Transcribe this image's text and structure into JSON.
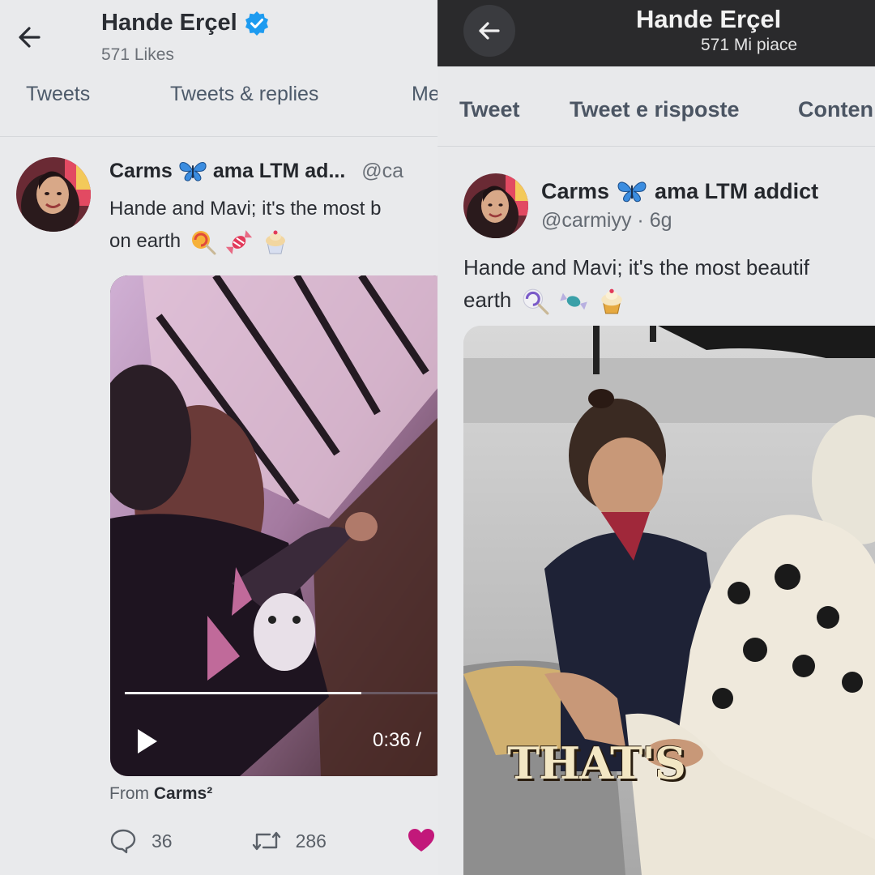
{
  "left": {
    "header": {
      "title": "Hande Erçel",
      "subtitle": "571 Likes"
    },
    "tabs": [
      "Tweets",
      "Tweets & replies",
      "Me"
    ],
    "tweet": {
      "name": "Carms",
      "name_suffix": "ama LTM ad...",
      "handle": "@ca",
      "text_line1": "Hande and Mavi; it's the most b",
      "text_line2": "on earth",
      "video_time": "0:36 /",
      "from_prefix": "From",
      "from_name": "Carms²",
      "reply_count": "36",
      "retweet_count": "286"
    },
    "colors": {
      "accent": "#1d9bf0",
      "like": "#c2187a"
    },
    "icons": [
      "back-arrow-icon",
      "verified-badge-icon",
      "butterfly-icon",
      "lollipop-icon",
      "candy-icon",
      "cupcake-icon",
      "play-icon",
      "reply-icon",
      "retweet-icon",
      "heart-icon"
    ]
  },
  "right": {
    "header": {
      "title": "Hande Erçel",
      "subtitle": "571 Mi piace"
    },
    "tabs": [
      "Tweet",
      "Tweet e risposte",
      "Conten"
    ],
    "tweet": {
      "name": "Carms",
      "name_suffix": "ama LTM addict",
      "handle": "@carmiyy · 6g",
      "text_line1": "Hande and Mavi; it's the most beautif",
      "text_line2": "earth",
      "image_caption": "THAT'S"
    },
    "icons": [
      "back-arrow-icon",
      "butterfly-icon",
      "lollipop-icon",
      "candy-icon",
      "cupcake-icon"
    ]
  }
}
